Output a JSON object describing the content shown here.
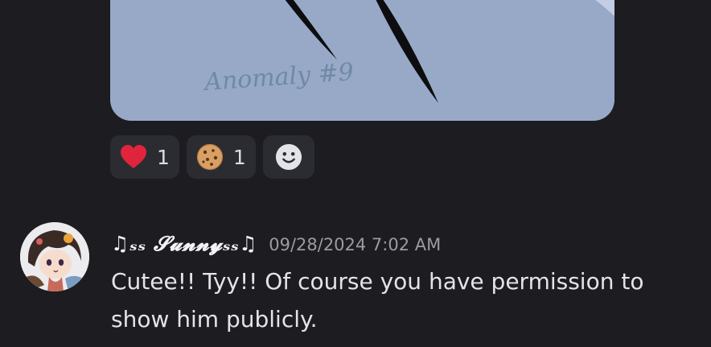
{
  "attachment": {
    "signature_text": "Anomaly #9",
    "background_color": "#98a9c8"
  },
  "reactions": [
    {
      "emoji": "red-heart-icon",
      "count": "1"
    },
    {
      "emoji": "cookie-icon",
      "count": "1"
    }
  ],
  "add_reaction": {
    "icon": "add-reaction-smiley-icon"
  },
  "message": {
    "username": "♫ₛₛ 𝓢𝓾𝓷𝓷𝔂ₛₛ♫",
    "timestamp": "09/28/2024 7:02 AM",
    "lines": [
      "Cutee!! Tyy!! Of course you have permission to",
      "show him publicly."
    ]
  },
  "colors": {
    "background": "#1c1c21",
    "reaction_bg": "#2b2c32",
    "timestamp": "#9b9ca3",
    "text": "#e3e4e8"
  }
}
